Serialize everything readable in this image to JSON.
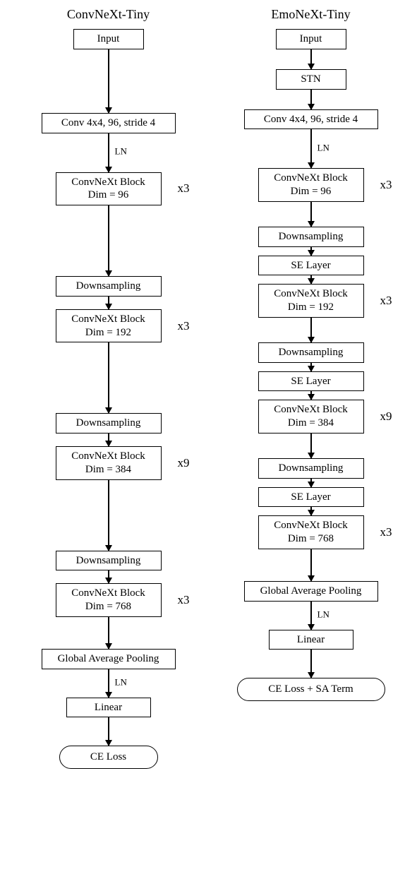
{
  "left": {
    "title": "ConvNeXt-Tiny",
    "input": "Input",
    "stem": "Conv 4x4, 96, stride 4",
    "ln": "LN",
    "block1": "ConvNeXt Block\nDim = 96",
    "mult1": "x3",
    "down1": "Downsampling",
    "block2": "ConvNeXt Block\nDim = 192",
    "mult2": "x3",
    "down2": "Downsampling",
    "block3": "ConvNeXt Block\nDim = 384",
    "mult3": "x9",
    "down3": "Downsampling",
    "block4": "ConvNeXt Block\nDim = 768",
    "mult4": "x3",
    "gap": "Global Average Pooling",
    "ln2": "LN",
    "linear": "Linear",
    "loss": "CE Loss"
  },
  "right": {
    "title": "EmoNeXt-Tiny",
    "input": "Input",
    "stn": "STN",
    "stem": "Conv 4x4, 96, stride 4",
    "ln": "LN",
    "block1": "ConvNeXt Block\nDim = 96",
    "mult1": "x3",
    "down1": "Downsampling",
    "se1": "SE Layer",
    "block2": "ConvNeXt Block\nDim = 192",
    "mult2": "x3",
    "down2": "Downsampling",
    "se2": "SE Layer",
    "block3": "ConvNeXt Block\nDim = 384",
    "mult3": "x9",
    "down3": "Downsampling",
    "se3": "SE Layer",
    "block4": "ConvNeXt Block\nDim = 768",
    "mult4": "x3",
    "gap": "Global Average Pooling",
    "ln2": "LN",
    "linear": "Linear",
    "loss": "CE Loss + SA Term"
  },
  "chart_data": {
    "type": "diagram",
    "description": "Side-by-side comparison of two CNN architectures.",
    "architectures": [
      {
        "name": "ConvNeXt-Tiny",
        "loss": "CE Loss",
        "layers": [
          {
            "type": "input"
          },
          {
            "type": "conv",
            "kernel": "4x4",
            "channels": 96,
            "stride": 4
          },
          {
            "type": "layernorm"
          },
          {
            "type": "convnext_block",
            "dim": 96,
            "repeat": 3
          },
          {
            "type": "downsampling"
          },
          {
            "type": "convnext_block",
            "dim": 192,
            "repeat": 3
          },
          {
            "type": "downsampling"
          },
          {
            "type": "convnext_block",
            "dim": 384,
            "repeat": 9
          },
          {
            "type": "downsampling"
          },
          {
            "type": "convnext_block",
            "dim": 768,
            "repeat": 3
          },
          {
            "type": "global_average_pooling"
          },
          {
            "type": "layernorm"
          },
          {
            "type": "linear"
          }
        ]
      },
      {
        "name": "EmoNeXt-Tiny",
        "loss": "CE Loss + SA Term",
        "layers": [
          {
            "type": "input"
          },
          {
            "type": "stn"
          },
          {
            "type": "conv",
            "kernel": "4x4",
            "channels": 96,
            "stride": 4
          },
          {
            "type": "layernorm"
          },
          {
            "type": "convnext_block",
            "dim": 96,
            "repeat": 3
          },
          {
            "type": "downsampling"
          },
          {
            "type": "se_layer"
          },
          {
            "type": "convnext_block",
            "dim": 192,
            "repeat": 3
          },
          {
            "type": "downsampling"
          },
          {
            "type": "se_layer"
          },
          {
            "type": "convnext_block",
            "dim": 384,
            "repeat": 9
          },
          {
            "type": "downsampling"
          },
          {
            "type": "se_layer"
          },
          {
            "type": "convnext_block",
            "dim": 768,
            "repeat": 3
          },
          {
            "type": "global_average_pooling"
          },
          {
            "type": "layernorm"
          },
          {
            "type": "linear"
          }
        ]
      }
    ]
  }
}
